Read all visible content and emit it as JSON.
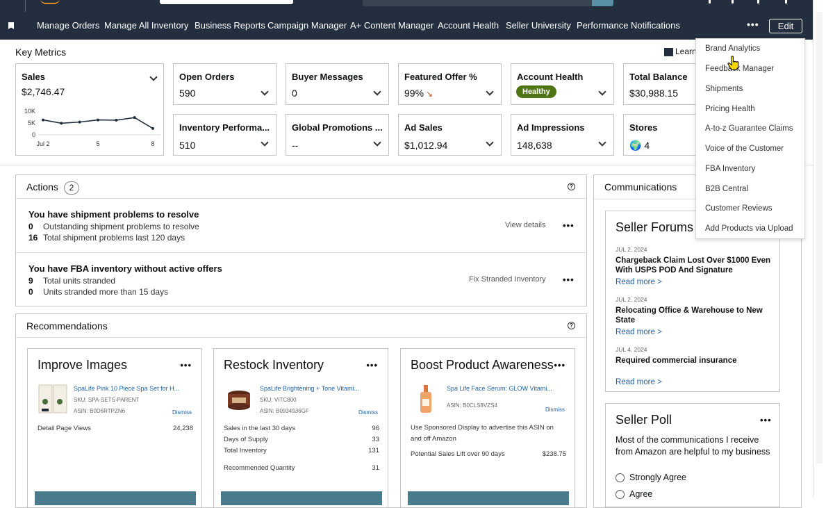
{
  "nav": {
    "items": [
      "Manage Orders",
      "Manage All Inventory",
      "Business Reports",
      "Campaign Manager",
      "A+ Content Manager",
      "Account Health",
      "Seller University",
      "Performance Notifications"
    ],
    "edit_label": "Edit"
  },
  "key_metrics": {
    "title": "Key Metrics",
    "learn_label": "Learn",
    "sales": {
      "title": "Sales",
      "value": "$2,746.47",
      "chart_data": {
        "type": "line",
        "x_ticks": [
          "Jul 2",
          "5",
          "8"
        ],
        "y_ticks": [
          "10K",
          "5K",
          "0"
        ],
        "values": [
          6300,
          4900,
          5400,
          6300,
          6200,
          7300,
          2700
        ],
        "ylim": [
          0,
          10000
        ]
      }
    },
    "cards": [
      {
        "title": "Open Orders",
        "value": "590"
      },
      {
        "title": "Buyer Messages",
        "value": "0"
      },
      {
        "title": "Featured Offer %",
        "value": "99%"
      },
      {
        "title": "Account Health",
        "value": "Healthy"
      },
      {
        "title": "Total Balance",
        "value": "$30,988.15"
      },
      {
        "title": "Inventory Performa...",
        "value": "510"
      },
      {
        "title": "Global Promotions ...",
        "value": "--"
      },
      {
        "title": "Ad Sales",
        "value": "$1,012.94"
      },
      {
        "title": "Ad Impressions",
        "value": "148,638"
      },
      {
        "title": "Stores",
        "value": "4"
      }
    ]
  },
  "actions": {
    "title": "Actions",
    "count": "2",
    "help": "?",
    "items": [
      {
        "title": "You have shipment problems to resolve",
        "rows": [
          {
            "n": "0",
            "text": "Outstanding shipment problems to resolve"
          },
          {
            "n": "16",
            "text": "Total shipment problems last 120 days"
          }
        ],
        "link": "View details"
      },
      {
        "title": "You have FBA inventory without active offers",
        "rows": [
          {
            "n": "9",
            "text": "Total units stranded"
          },
          {
            "n": "0",
            "text": "Units stranded more than 15 days"
          }
        ],
        "link": "Fix Stranded Inventory"
      }
    ]
  },
  "recommendations": {
    "title": "Recommendations",
    "help": "?",
    "cards": [
      {
        "title": "Improve Images",
        "product": "SpaLife Pink 10 Piece Spa Set for H...",
        "sku": "SKU: SPA-SETS-PARENT",
        "asin": "ASIN: B0D6RTPZN6",
        "dismiss": "Dismiss",
        "metrics": [
          {
            "k": "Detail Page Views",
            "v": "24,238"
          }
        ]
      },
      {
        "title": "Restock Inventory",
        "product": "SpaLife Brightening + Tone Vitami...",
        "sku": "SKU: VITC800",
        "asin": "ASIN: B0934936GF",
        "dismiss": "Dismiss",
        "metrics": [
          {
            "k": "Sales in the last 30 days",
            "v": "96"
          },
          {
            "k": "Days of Supply",
            "v": "33"
          },
          {
            "k": "Total Inventory",
            "v": "131"
          },
          {
            "k": "Recommended Quantity",
            "v": "31"
          }
        ]
      },
      {
        "title": "Boost Product Awareness",
        "product": "Spa Life Face Serum: GLOW Vitami...",
        "asin": "ASIN: B0CLS8VZS4",
        "dismiss": "Dismiss",
        "description": "Use Sponsored Display to advertise this ASIN on and off Amazon",
        "metrics": [
          {
            "k": "Potential Sales Lift over 90 days",
            "v": "$238.75"
          }
        ]
      }
    ]
  },
  "communications": {
    "title": "Communications",
    "forums": {
      "title": "Seller Forums",
      "posts": [
        {
          "date": "JUL 2, 2024",
          "title": "Chargeback Claim Lost Over $1000 Even With USPS POD And Signature",
          "link": "Read more >"
        },
        {
          "date": "JUL 2, 2024",
          "title": "Relocating Office & Warehouse to New State",
          "link": "Read more >"
        },
        {
          "date": "JUL 4, 2024",
          "title": "Required commercial insurance",
          "link": "Read more >"
        }
      ]
    },
    "poll": {
      "title": "Seller Poll",
      "question": "Most of the communications I receive from Amazon are helpful to my business",
      "options": [
        "Strongly Agree",
        "Agree"
      ]
    }
  },
  "dropdown": {
    "items": [
      "Brand Analytics",
      "Feedback Manager",
      "Shipments",
      "Pricing Health",
      "A-to-z Guarantee Claims",
      "Voice of the Customer",
      "FBA Inventory",
      "B2B Central",
      "Customer Reviews",
      "Add Products via Upload"
    ]
  }
}
